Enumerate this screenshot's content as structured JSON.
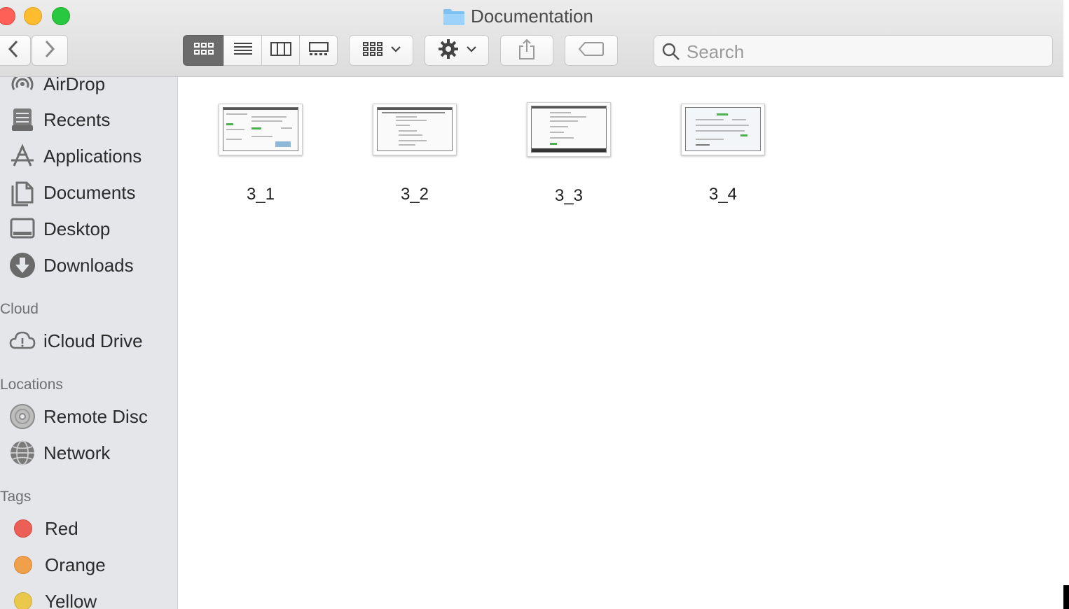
{
  "window": {
    "title": "Documentation"
  },
  "toolbar": {
    "search_placeholder": "Search"
  },
  "sidebar": {
    "favorites": [
      {
        "label": "AirDrop",
        "icon": "airdrop-icon"
      },
      {
        "label": "Recents",
        "icon": "recents-icon"
      },
      {
        "label": "Applications",
        "icon": "applications-icon"
      },
      {
        "label": "Documents",
        "icon": "documents-icon"
      },
      {
        "label": "Desktop",
        "icon": "desktop-icon"
      },
      {
        "label": "Downloads",
        "icon": "downloads-icon"
      }
    ],
    "icloud_heading": "Cloud",
    "icloud": [
      {
        "label": "iCloud Drive",
        "icon": "cloud-icon"
      }
    ],
    "locations_heading": "Locations",
    "locations": [
      {
        "label": "Remote Disc",
        "icon": "disc-icon"
      },
      {
        "label": "Network",
        "icon": "globe-icon"
      }
    ],
    "tags_heading": "Tags",
    "tags": [
      {
        "label": "Red",
        "color": "#ec5f57"
      },
      {
        "label": "Orange",
        "color": "#f0a04b"
      },
      {
        "label": "Yellow",
        "color": "#e9c84c"
      }
    ]
  },
  "files": [
    {
      "name": "3_1"
    },
    {
      "name": "3_2"
    },
    {
      "name": "3_3"
    },
    {
      "name": "3_4"
    }
  ]
}
